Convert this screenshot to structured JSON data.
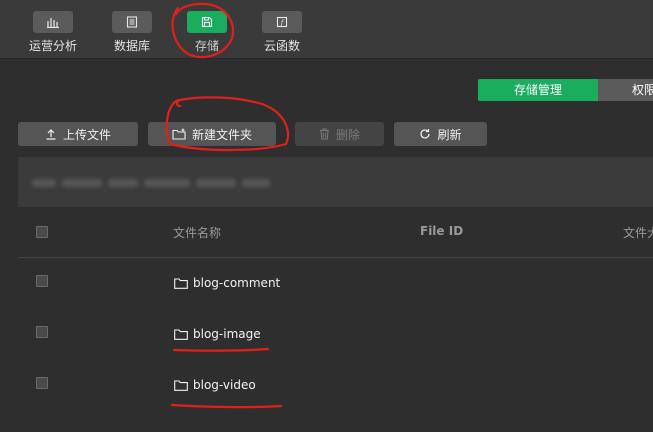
{
  "toolbar": {
    "items": [
      {
        "label": "运营分析",
        "icon": "bar-chart-icon",
        "active": false
      },
      {
        "label": "数据库",
        "icon": "database-icon",
        "active": false
      },
      {
        "label": "存储",
        "icon": "save-icon",
        "active": true
      },
      {
        "label": "云函数",
        "icon": "function-icon",
        "active": false
      }
    ]
  },
  "tabs": {
    "storage": "存储管理",
    "permissions": "权限"
  },
  "actions": {
    "upload": "上传文件",
    "new_folder": "新建文件夹",
    "delete": "删除",
    "refresh": "刷新"
  },
  "table": {
    "columns": [
      "文件名称",
      "File ID",
      "文件大小"
    ],
    "rows": [
      {
        "name": "blog-comment",
        "icon": "folder-icon"
      },
      {
        "name": "blog-image",
        "icon": "folder-icon"
      },
      {
        "name": "blog-video",
        "icon": "folder-icon"
      }
    ]
  },
  "colors": {
    "accent": "#1aad5e",
    "background": "#2e2e2e",
    "annotation": "#e0201c"
  }
}
